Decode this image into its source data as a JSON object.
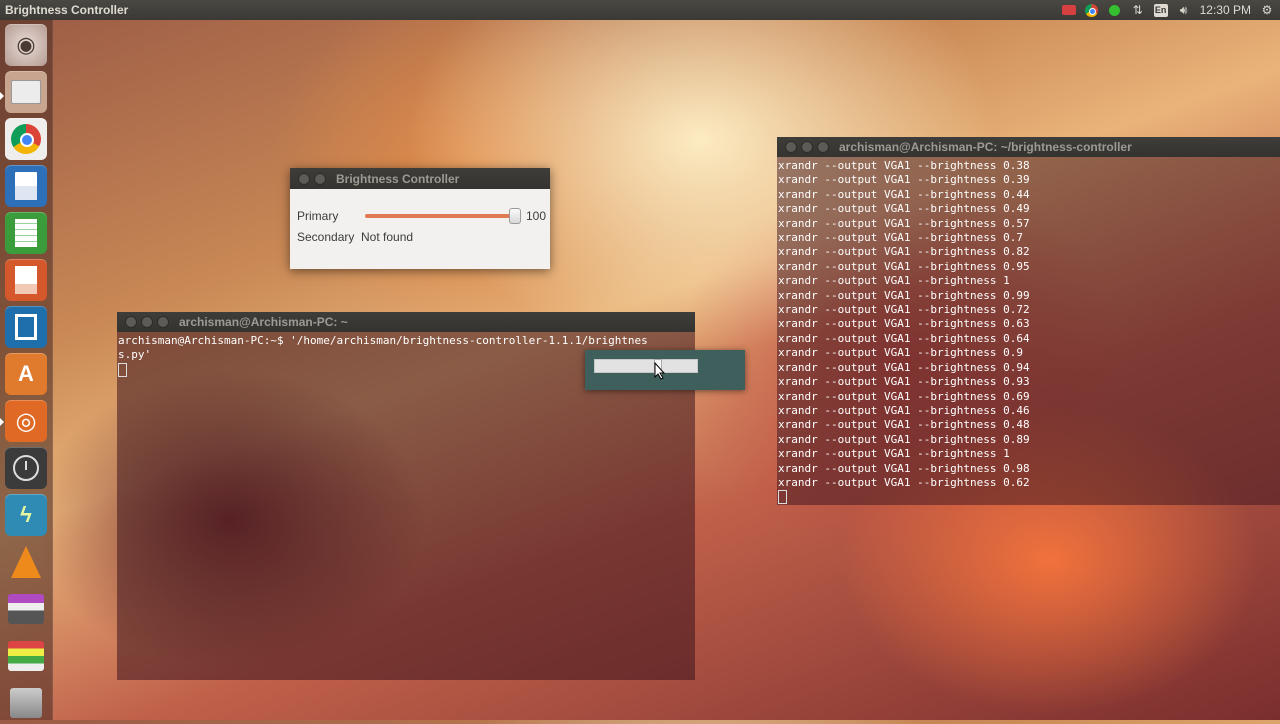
{
  "top_panel": {
    "app_title": "Brightness Controller",
    "indicators": {
      "language": "En",
      "clock": "12:30 PM"
    }
  },
  "launcher": {
    "items": [
      {
        "name": "dash-home",
        "icon": "ubuntu-logo-icon",
        "color": "#c9b7b0"
      },
      {
        "name": "files",
        "icon": "folder-icon",
        "color": "#c7a48f"
      },
      {
        "name": "chrome",
        "icon": "chrome-icon",
        "color": "#e9e9e9"
      },
      {
        "name": "writer",
        "icon": "document-icon",
        "color": "#2d6fb8"
      },
      {
        "name": "calc",
        "icon": "spreadsheet-icon",
        "color": "#3a9c3a"
      },
      {
        "name": "impress",
        "icon": "presentation-icon",
        "color": "#d5582c"
      },
      {
        "name": "brackets",
        "icon": "brackets-icon",
        "color": "#1f6fad"
      },
      {
        "name": "software-center",
        "icon": "shopping-bag-icon",
        "color": "#e07a2c"
      },
      {
        "name": "ubuntu-one",
        "icon": "ubuntu-circle-icon",
        "color": "#e06a25"
      },
      {
        "name": "system-settings",
        "icon": "clock-icon",
        "color": "#3b3b3b"
      },
      {
        "name": "power-tool",
        "icon": "lightning-icon",
        "color": "#2f8bb3"
      },
      {
        "name": "vlc",
        "icon": "traffic-cone-icon",
        "color": "#ee8a1c"
      },
      {
        "name": "scanner",
        "icon": "printer-icon",
        "color": "#8a4aa0"
      },
      {
        "name": "workspace",
        "icon": "stack-icon",
        "color": "#6a6a6a"
      },
      {
        "name": "trash",
        "icon": "trash-icon",
        "color": "#7a7a7a"
      }
    ]
  },
  "brightness_window": {
    "title": "Brightness Controller",
    "primary_label": "Primary",
    "primary_value": "100",
    "primary_level": 1.0,
    "secondary_label": "Secondary",
    "secondary_value": "Not found"
  },
  "terminal_left": {
    "title": "archisman@Archisman-PC: ~",
    "lines": [
      "archisman@Archisman-PC:~$ '/home/archisman/brightness-controller-1.1.1/brightnes",
      "s.py'"
    ]
  },
  "terminal_right": {
    "title": "archisman@Archisman-PC: ~/brightness-controller",
    "lines": [
      "xrandr --output VGA1 --brightness 0.38",
      "xrandr --output VGA1 --brightness 0.39",
      "xrandr --output VGA1 --brightness 0.44",
      "xrandr --output VGA1 --brightness 0.49",
      "xrandr --output VGA1 --brightness 0.57",
      "xrandr --output VGA1 --brightness 0.7",
      "xrandr --output VGA1 --brightness 0.82",
      "xrandr --output VGA1 --brightness 0.95",
      "xrandr --output VGA1 --brightness 1",
      "xrandr --output VGA1 --brightness 0.99",
      "xrandr --output VGA1 --brightness 0.72",
      "xrandr --output VGA1 --brightness 0.63",
      "xrandr --output VGA1 --brightness 0.64",
      "xrandr --output VGA1 --brightness 0.9",
      "xrandr --output VGA1 --brightness 0.94",
      "xrandr --output VGA1 --brightness 0.93",
      "xrandr --output VGA1 --brightness 0.69",
      "xrandr --output VGA1 --brightness 0.46",
      "xrandr --output VGA1 --brightness 0.48",
      "xrandr --output VGA1 --brightness 0.89",
      "xrandr --output VGA1 --brightness 1",
      "xrandr --output VGA1 --brightness 0.98",
      "xrandr --output VGA1 --brightness 0.62"
    ]
  },
  "popup": {
    "slider_level": 0.6
  }
}
